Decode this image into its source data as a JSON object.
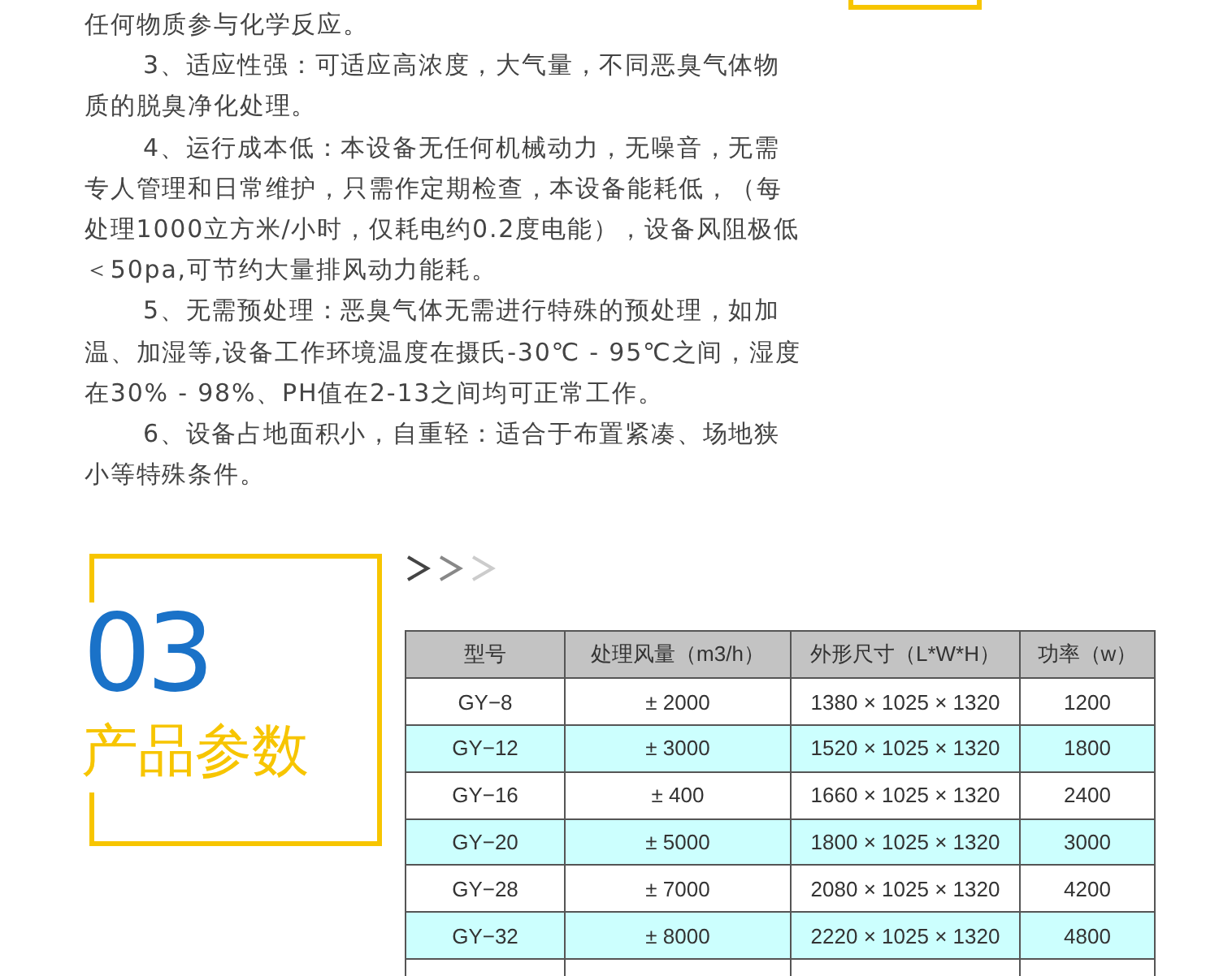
{
  "intro_text": [
    {
      "indent": false,
      "lines": [
        "任何物质参与化学反应。"
      ]
    },
    {
      "indent": true,
      "lines": [
        "3、适应性强：可适应高浓度，大气量，不同恶臭气体物",
        "质的脱臭净化处理。"
      ]
    },
    {
      "indent": true,
      "lines": [
        "4、运行成本低：本设备无任何机械动力，无噪音，无需",
        "专人管理和日常维护，只需作定期检查，本设备能耗低，（每",
        "处理1000立方米/小时，仅耗电约0.2度电能），设备风阻极低",
        "＜50pa,可节约大量排风动力能耗。"
      ]
    },
    {
      "indent": true,
      "lines": [
        "5、无需预处理：恶臭气体无需进行特殊的预处理，如加",
        "温、加湿等,设备工作环境温度在摄氏-30℃ - 95℃之间，湿度",
        "在30% - 98%、PH值在2-13之间均可正常工作。"
      ]
    },
    {
      "indent": true,
      "lines": [
        "6、设备占地面积小，自重轻：适合于布置紧凑、场地狭",
        "小等特殊条件。"
      ]
    }
  ],
  "section": {
    "number": "03",
    "title": "产品参数"
  },
  "table": {
    "columns": [
      "型号",
      "处理风量（m3/h）",
      "外形尺寸（L*W*H）",
      "功率（w）"
    ],
    "rows": [
      [
        "GY−8",
        "± 2000",
        "1380 × 1025 × 1320",
        "1200"
      ],
      [
        "GY−12",
        "± 3000",
        "1520 × 1025 × 1320",
        "1800"
      ],
      [
        "GY−16",
        "± 400",
        "1660 × 1025 × 1320",
        "2400"
      ],
      [
        "GY−20",
        "± 5000",
        "1800 × 1025 × 1320",
        "3000"
      ],
      [
        "GY−28",
        "± 7000",
        "2080 × 1025 × 1320",
        "4200"
      ],
      [
        "GY−32",
        "± 8000",
        "2220 × 1025 × 1320",
        "4800"
      ]
    ]
  }
}
